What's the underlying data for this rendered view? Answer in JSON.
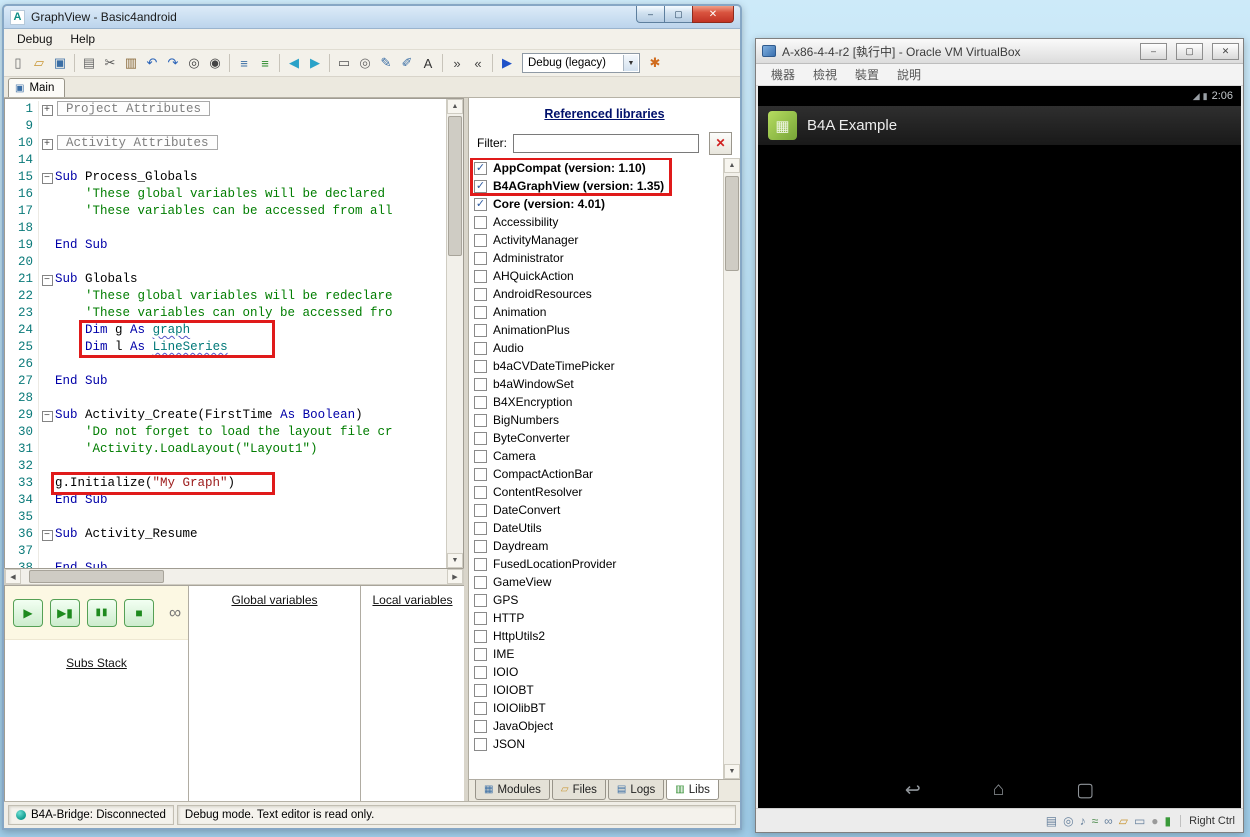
{
  "ide": {
    "title": "GraphView - Basic4android",
    "app_icon_letter": "A",
    "window_buttons": {
      "minimize": "–",
      "maximize": "▢",
      "close": "✕"
    },
    "menus": [
      "Debug",
      "Help"
    ],
    "toolbar": {
      "icons_left": [
        {
          "name": "new-file-icon",
          "glyph": "▯",
          "color": "#6b6b6b"
        },
        {
          "name": "open-folder-icon",
          "glyph": "▱",
          "color": "#c89530"
        },
        {
          "name": "save-icon",
          "glyph": "▣",
          "color": "#3a6ea5"
        },
        {
          "name": "separator"
        },
        {
          "name": "copy-icon",
          "glyph": "▤",
          "color": "#6b6b6b"
        },
        {
          "name": "cut-icon",
          "glyph": "✂",
          "color": "#555555"
        },
        {
          "name": "paste-icon",
          "glyph": "▥",
          "color": "#8a6a3a"
        },
        {
          "name": "undo-icon",
          "glyph": "↶",
          "color": "#2a63b8"
        },
        {
          "name": "redo-icon",
          "glyph": "↷",
          "color": "#2a63b8"
        },
        {
          "name": "find-icon",
          "glyph": "◎",
          "color": "#444444"
        },
        {
          "name": "find-next-icon",
          "glyph": "◉",
          "color": "#444444"
        },
        {
          "name": "separator"
        },
        {
          "name": "format-code-icon",
          "glyph": "≡",
          "color": "#3a6ea5"
        },
        {
          "name": "sort-members-icon",
          "glyph": "≡",
          "color": "#2a8a2a"
        },
        {
          "name": "separator"
        },
        {
          "name": "navigate-back-icon",
          "glyph": "◀",
          "color": "#2aa2c8"
        },
        {
          "name": "navigate-forward-icon",
          "glyph": "▶",
          "color": "#2aa2c8"
        },
        {
          "name": "separator"
        },
        {
          "name": "select-region-icon",
          "glyph": "▭",
          "color": "#555555"
        },
        {
          "name": "zoom-region-icon",
          "glyph": "◎",
          "color": "#666666"
        },
        {
          "name": "comment-icon",
          "glyph": "✎",
          "color": "#3a6ea5"
        },
        {
          "name": "uncomment-icon",
          "glyph": "✐",
          "color": "#3a6ea5"
        },
        {
          "name": "font-size-icon",
          "glyph": "A",
          "color": "#333333"
        },
        {
          "name": "separator"
        },
        {
          "name": "indent-icon",
          "glyph": "»",
          "color": "#444444"
        },
        {
          "name": "outdent-icon",
          "glyph": "«",
          "color": "#444444"
        },
        {
          "name": "separator"
        },
        {
          "name": "compile-run-icon",
          "glyph": "▶",
          "color": "#1f52c8"
        }
      ],
      "build_config": "Debug (legacy)",
      "icons_right": [
        {
          "name": "refresh-libraries-icon",
          "glyph": "✱",
          "color": "#d06c1e"
        }
      ]
    },
    "tabs": [
      "Main"
    ],
    "editor": {
      "lines": [
        {
          "n": "1",
          "fold": "plus",
          "box": "Project Attributes"
        },
        {
          "n": "9"
        },
        {
          "n": "10",
          "fold": "plus",
          "box": "Activity Attributes"
        },
        {
          "n": "14"
        },
        {
          "n": "15",
          "fold": "minus",
          "toks": [
            [
              "k",
              "Sub"
            ],
            [
              "p",
              " Process_Globals"
            ]
          ]
        },
        {
          "n": "16",
          "toks": [
            [
              "c",
              "    'These global variables will be declared"
            ]
          ]
        },
        {
          "n": "17",
          "toks": [
            [
              "c",
              "    'These variables can be accessed from all"
            ]
          ]
        },
        {
          "n": "18"
        },
        {
          "n": "19",
          "toks": [
            [
              "k",
              "End Sub"
            ]
          ]
        },
        {
          "n": "20"
        },
        {
          "n": "21",
          "fold": "minus",
          "toks": [
            [
              "k",
              "Sub"
            ],
            [
              "p",
              " Globals"
            ]
          ]
        },
        {
          "n": "22",
          "toks": [
            [
              "c",
              "    'These global variables will be redeclare"
            ]
          ]
        },
        {
          "n": "23",
          "toks": [
            [
              "c",
              "    'These variables can only be accessed fro"
            ]
          ]
        },
        {
          "n": "24",
          "toks": [
            [
              "p",
              "    "
            ],
            [
              "k",
              "Dim"
            ],
            [
              "p",
              " g "
            ],
            [
              "k",
              "As"
            ],
            [
              "p",
              " "
            ],
            [
              "t",
              "graph"
            ]
          ]
        },
        {
          "n": "25",
          "toks": [
            [
              "p",
              "    "
            ],
            [
              "k",
              "Dim"
            ],
            [
              "p",
              " l "
            ],
            [
              "k",
              "As"
            ],
            [
              "p",
              " "
            ],
            [
              "t",
              "LineSeries"
            ]
          ]
        },
        {
          "n": "26"
        },
        {
          "n": "27",
          "toks": [
            [
              "k",
              "End Sub"
            ]
          ]
        },
        {
          "n": "28"
        },
        {
          "n": "29",
          "fold": "minus",
          "toks": [
            [
              "k",
              "Sub"
            ],
            [
              "p",
              " Activity_Create(FirstTime "
            ],
            [
              "k",
              "As"
            ],
            [
              "k",
              " Boolean"
            ],
            [
              "p",
              ")"
            ]
          ]
        },
        {
          "n": "30",
          "toks": [
            [
              "c",
              "    'Do not forget to load the layout file cr"
            ]
          ]
        },
        {
          "n": "31",
          "toks": [
            [
              "c",
              "    'Activity.LoadLayout(\"Layout1\")"
            ]
          ]
        },
        {
          "n": "32"
        },
        {
          "n": "33",
          "toks": [
            [
              "p",
              "g.Initialize("
            ],
            [
              "s",
              "\"My Graph\""
            ],
            [
              "p",
              ")"
            ]
          ]
        },
        {
          "n": "34",
          "toks": [
            [
              "k",
              "End Sub"
            ]
          ]
        },
        {
          "n": "35"
        },
        {
          "n": "36",
          "fold": "minus",
          "toks": [
            [
              "k",
              "Sub"
            ],
            [
              "p",
              " Activity_Resume"
            ]
          ]
        },
        {
          "n": "37"
        },
        {
          "n": "38",
          "toks": [
            [
              "k",
              "End Sub"
            ]
          ]
        }
      ]
    },
    "libraries": {
      "header": "Referenced libraries",
      "filter_label": "Filter:",
      "filter_value": "",
      "items": [
        {
          "label": "AppCompat (version: 1.10)",
          "checked": true
        },
        {
          "label": "B4AGraphView (version: 1.35)",
          "checked": true
        },
        {
          "label": "Core (version: 4.01)",
          "checked": true
        },
        {
          "label": "Accessibility",
          "checked": false
        },
        {
          "label": "ActivityManager",
          "checked": false
        },
        {
          "label": "Administrator",
          "checked": false
        },
        {
          "label": "AHQuickAction",
          "checked": false
        },
        {
          "label": "AndroidResources",
          "checked": false
        },
        {
          "label": "Animation",
          "checked": false
        },
        {
          "label": "AnimationPlus",
          "checked": false
        },
        {
          "label": "Audio",
          "checked": false
        },
        {
          "label": "b4aCVDateTimePicker",
          "checked": false
        },
        {
          "label": "b4aWindowSet",
          "checked": false
        },
        {
          "label": "B4XEncryption",
          "checked": false
        },
        {
          "label": "BigNumbers",
          "checked": false
        },
        {
          "label": "ByteConverter",
          "checked": false
        },
        {
          "label": "Camera",
          "checked": false
        },
        {
          "label": "CompactActionBar",
          "checked": false
        },
        {
          "label": "ContentResolver",
          "checked": false
        },
        {
          "label": "DateConvert",
          "checked": false
        },
        {
          "label": "DateUtils",
          "checked": false
        },
        {
          "label": "Daydream",
          "checked": false
        },
        {
          "label": "FusedLocationProvider",
          "checked": false
        },
        {
          "label": "GameView",
          "checked": false
        },
        {
          "label": "GPS",
          "checked": false
        },
        {
          "label": "HTTP",
          "checked": false
        },
        {
          "label": "HttpUtils2",
          "checked": false
        },
        {
          "label": "IME",
          "checked": false
        },
        {
          "label": "IOIO",
          "checked": false
        },
        {
          "label": "IOIOBT",
          "checked": false
        },
        {
          "label": "IOIOlibBT",
          "checked": false
        },
        {
          "label": "JavaObject",
          "checked": false
        },
        {
          "label": "JSON",
          "checked": false
        }
      ],
      "tabs": [
        {
          "label": "Modules",
          "icon": "▦",
          "color": "#3a6ea5",
          "active": false
        },
        {
          "label": "Files",
          "icon": "▱",
          "color": "#c89530",
          "active": false
        },
        {
          "label": "Logs",
          "icon": "▤",
          "color": "#3a6ea5",
          "active": false
        },
        {
          "label": "Libs",
          "icon": "▥",
          "color": "#2a8a2a",
          "active": true
        }
      ]
    },
    "debug_panel": {
      "buttons": [
        {
          "name": "run-button",
          "glyph": "▶"
        },
        {
          "name": "run-to-cursor-button",
          "glyph": "▶▮"
        },
        {
          "name": "pause-button",
          "glyph": "▮▮"
        },
        {
          "name": "stop-button",
          "glyph": "■"
        }
      ],
      "link_icon": "∞",
      "subs_stack_label": "Subs Stack",
      "global_vars_label": "Global variables",
      "local_vars_label": "Local variables"
    },
    "statusbar": {
      "bridge": "B4A-Bridge: Disconnected",
      "mode": "Debug mode. Text editor is read only."
    }
  },
  "vbox": {
    "title": "A-x86-4-4-r2 [執行中] - Oracle VM VirtualBox",
    "window_buttons": {
      "minimize": "–",
      "maximize": "▢",
      "close": "✕"
    },
    "menus": [
      "機器",
      "檢視",
      "裝置",
      "說明"
    ],
    "android": {
      "status_icons": [
        {
          "name": "signal-icon",
          "glyph": "◢"
        },
        {
          "name": "battery-icon",
          "glyph": "▮"
        }
      ],
      "status_time": "2:06",
      "app_icon_glyph": "▦",
      "app_title": "B4A Example",
      "nav_icons": [
        {
          "name": "back-icon",
          "glyph": "↩"
        },
        {
          "name": "home-icon",
          "glyph": "⌂"
        },
        {
          "name": "recents-icon",
          "glyph": "▢"
        }
      ]
    },
    "statusbar": {
      "icons": [
        {
          "name": "hard-disk-icon",
          "glyph": "▤",
          "color": "#68829e"
        },
        {
          "name": "optical-disk-icon",
          "glyph": "◎",
          "color": "#68829e"
        },
        {
          "name": "audio-icon",
          "glyph": "♪",
          "color": "#68829e"
        },
        {
          "name": "network-icon",
          "glyph": "≈",
          "color": "#4a8a4a"
        },
        {
          "name": "usb-icon",
          "glyph": "∞",
          "color": "#68829e"
        },
        {
          "name": "shared-folder-icon",
          "glyph": "▱",
          "color": "#c89530"
        },
        {
          "name": "display-icon",
          "glyph": "▭",
          "color": "#68829e"
        },
        {
          "name": "video-capture-icon",
          "glyph": "●",
          "color": "#9a9a9a"
        },
        {
          "name": "mouse-integration-icon",
          "glyph": "▮",
          "color": "#3a9a3a"
        }
      ],
      "host_key": "Right Ctrl"
    }
  }
}
